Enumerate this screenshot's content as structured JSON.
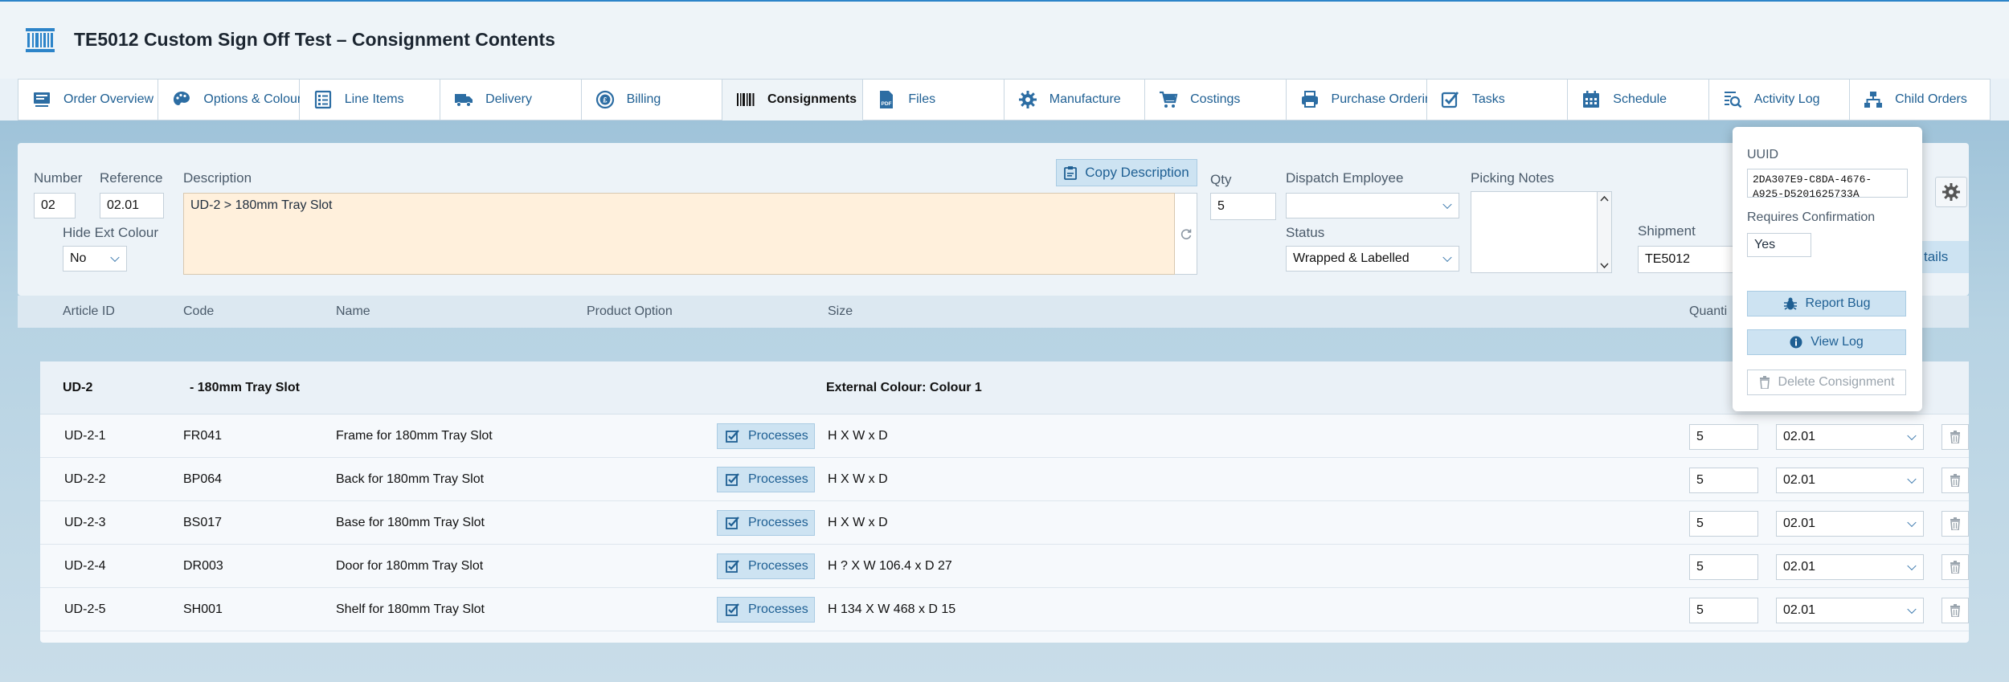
{
  "header": {
    "title": "TE5012 Custom Sign Off Test – Consignment Contents"
  },
  "tabs": [
    {
      "label": "Order Overview",
      "icon": "cart-list-icon"
    },
    {
      "label": "Options & Colours",
      "icon": "palette-icon"
    },
    {
      "label": "Line Items",
      "icon": "list-icon"
    },
    {
      "label": "Delivery",
      "icon": "truck-icon"
    },
    {
      "label": "Billing",
      "icon": "coin-icon"
    },
    {
      "label": "Consignments",
      "icon": "barcode-icon",
      "active": true
    },
    {
      "label": "Files",
      "icon": "pdf-icon"
    },
    {
      "label": "Manufacture",
      "icon": "gear-icon"
    },
    {
      "label": "Costings",
      "icon": "cart-icon"
    },
    {
      "label": "Purchase Ordering",
      "icon": "printer-icon"
    },
    {
      "label": "Tasks",
      "icon": "checkbox-icon"
    },
    {
      "label": "Schedule",
      "icon": "calendar-icon"
    },
    {
      "label": "Activity Log",
      "icon": "search-list-icon"
    },
    {
      "label": "Child Orders",
      "icon": "hierarchy-icon"
    }
  ],
  "form": {
    "number_label": "Number",
    "number_value": "02",
    "reference_label": "Reference",
    "reference_value": "02.01",
    "hide_ext_colour_label": "Hide Ext Colour",
    "hide_ext_colour_value": "No",
    "description_label": "Description",
    "description_value": "UD-2 > 180mm Tray Slot",
    "copy_description_label": "Copy Description",
    "qty_label": "Qty",
    "qty_value": "5",
    "dispatch_employee_label": "Dispatch Employee",
    "dispatch_employee_value": "",
    "status_label": "Status",
    "status_value": "Wrapped & Labelled",
    "picking_notes_label": "Picking Notes",
    "picking_notes_value": "",
    "shipment_label": "Shipment",
    "shipment_value": "TE5012",
    "details_button_partial": "tails"
  },
  "columns": {
    "article_id": "Article ID",
    "code": "Code",
    "name": "Name",
    "product_option": "Product Option",
    "size": "Size",
    "quantity_partial": "Quanti"
  },
  "group": {
    "article_id": "UD-2",
    "name": "- 180mm Tray Slot",
    "colour": "External Colour: Colour 1"
  },
  "rows": [
    {
      "article_id": "UD-2-1",
      "code": "FR041",
      "name": "Frame for 180mm Tray Slot",
      "processes": "Processes",
      "size": "H  X W  x D",
      "qty": "5",
      "ref": "02.01"
    },
    {
      "article_id": "UD-2-2",
      "code": "BP064",
      "name": "Back for 180mm Tray Slot",
      "processes": "Processes",
      "size": "H  X W  x D",
      "qty": "5",
      "ref": "02.01"
    },
    {
      "article_id": "UD-2-3",
      "code": "BS017",
      "name": "Base for 180mm Tray Slot",
      "processes": "Processes",
      "size": "H  X W  x D",
      "qty": "5",
      "ref": "02.01"
    },
    {
      "article_id": "UD-2-4",
      "code": "DR003",
      "name": "Door for 180mm Tray Slot",
      "processes": "Processes",
      "size": "H ? X W 106.4 x D 27",
      "qty": "5",
      "ref": "02.01"
    },
    {
      "article_id": "UD-2-5",
      "code": "SH001",
      "name": "Shelf for 180mm Tray Slot",
      "processes": "Processes",
      "size": "H 134 X W 468 x D 15",
      "qty": "5",
      "ref": "02.01"
    }
  ],
  "popover": {
    "uuid_label": "UUID",
    "uuid_value": "2DA307E9-C8DA-4676-A925-D5201625733A",
    "requires_confirmation_label": "Requires Confirmation",
    "requires_confirmation_value": "Yes",
    "report_bug": "Report Bug",
    "view_log": "View Log",
    "delete_consignment": "Delete Consignment"
  },
  "colors": {
    "accent": "#2c84c9",
    "button_bg": "#cde3f2",
    "description_bg": "#fff0dc"
  }
}
